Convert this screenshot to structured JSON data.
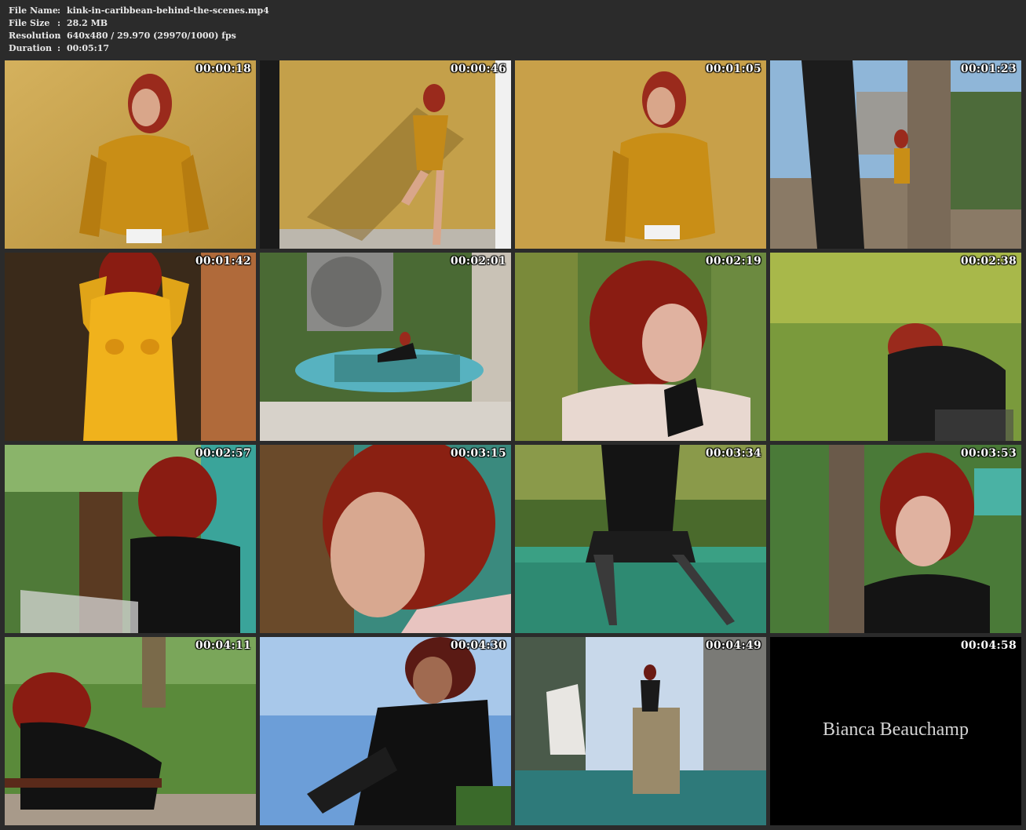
{
  "info": {
    "file_name_label": "File Name",
    "file_name": "kink-in-caribbean-behind-the-scenes.mp4",
    "file_size_label": "File Size",
    "file_size": "28.2 MB",
    "resolution_label": "Resolution",
    "resolution": "640x480 / 29.970 (29970/1000) fps",
    "duration_label": "Duration",
    "duration": "00:05:17",
    "separator": ":"
  },
  "thumbnails": [
    {
      "timestamp": "00:00:18"
    },
    {
      "timestamp": "00:00:46"
    },
    {
      "timestamp": "00:01:05"
    },
    {
      "timestamp": "00:01:23"
    },
    {
      "timestamp": "00:01:42"
    },
    {
      "timestamp": "00:02:01"
    },
    {
      "timestamp": "00:02:19"
    },
    {
      "timestamp": "00:02:38"
    },
    {
      "timestamp": "00:02:57"
    },
    {
      "timestamp": "00:03:15"
    },
    {
      "timestamp": "00:03:34"
    },
    {
      "timestamp": "00:03:53"
    },
    {
      "timestamp": "00:04:11"
    },
    {
      "timestamp": "00:04:30"
    },
    {
      "timestamp": "00:04:49"
    },
    {
      "timestamp": "00:04:58",
      "caption": "Bianca Beauchamp"
    }
  ],
  "colors": {
    "background": "#2b2b2b",
    "text": "#e8e8e8"
  }
}
